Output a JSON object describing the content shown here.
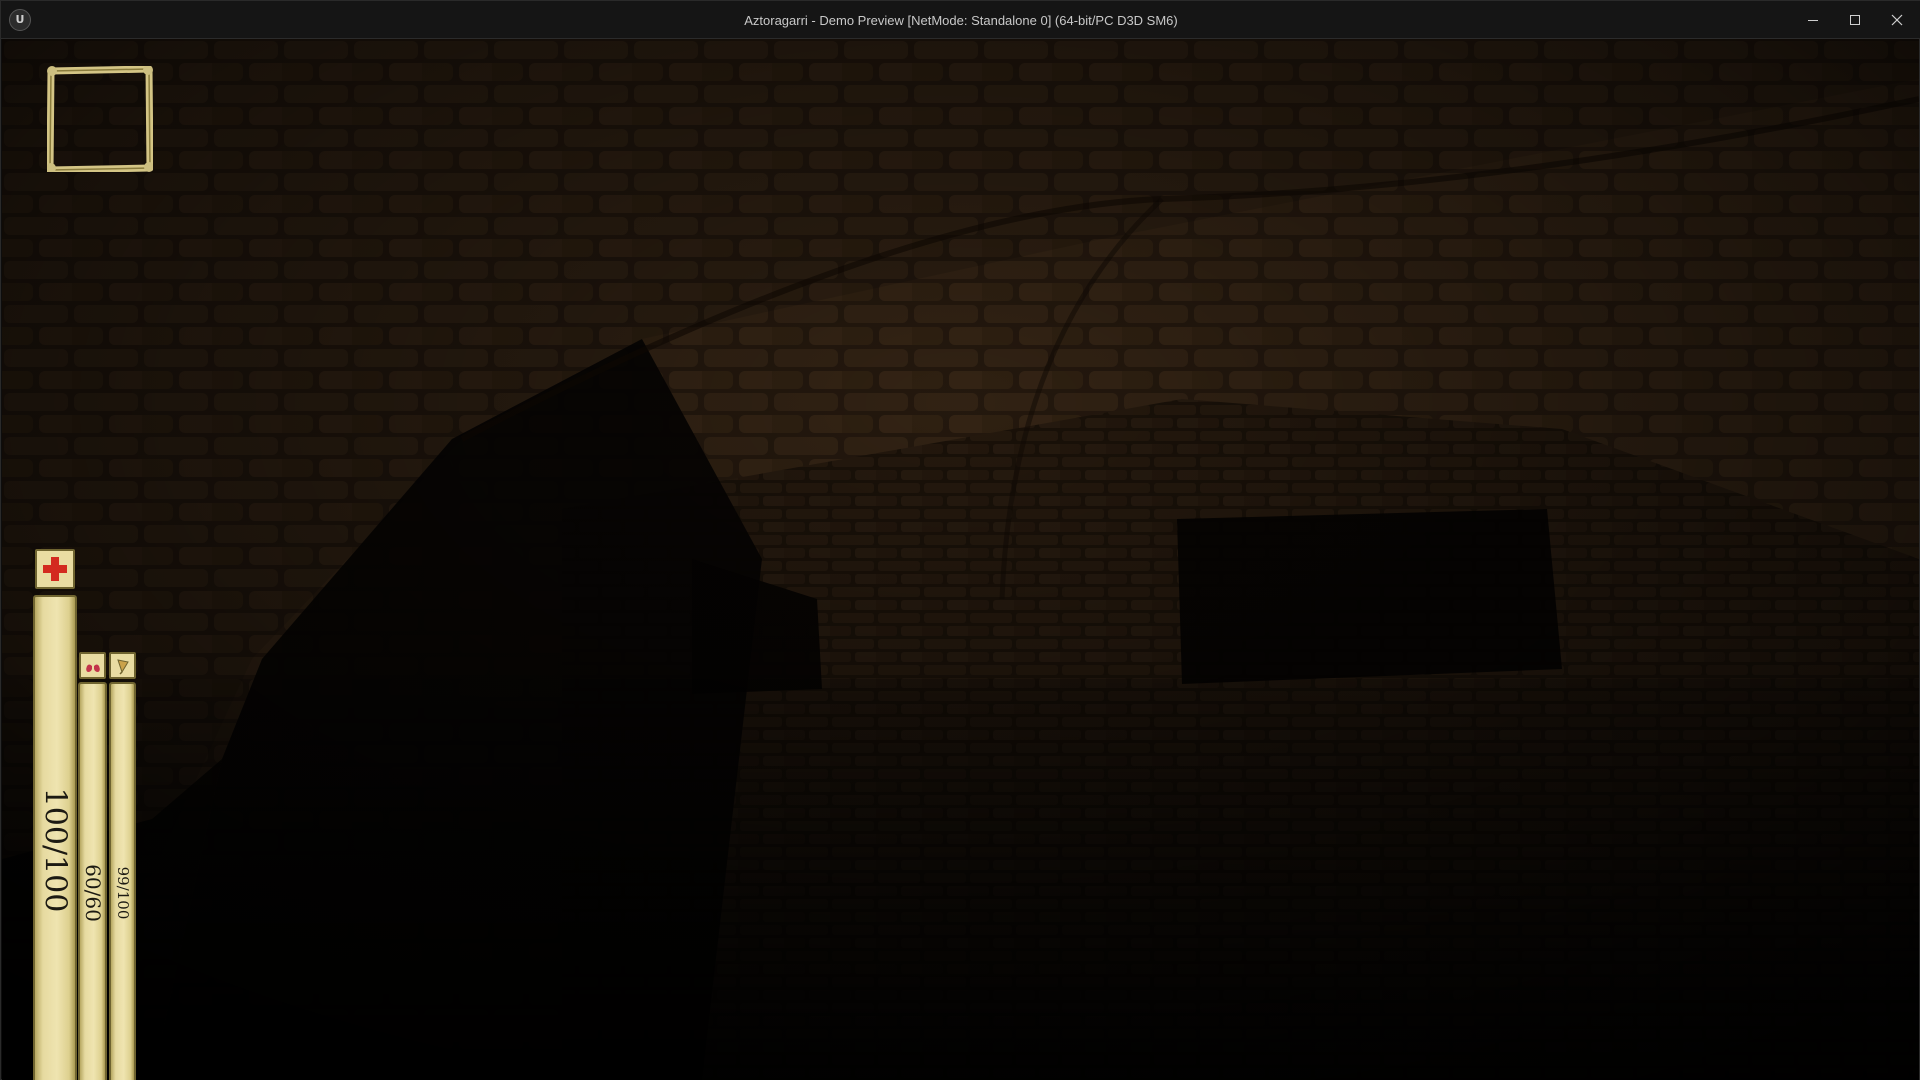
{
  "window": {
    "title": "Aztoragarri - Demo Preview [NetMode: Standalone 0]  (64-bit/PC D3D SM6)",
    "logo_text": "U"
  },
  "hud": {
    "health": {
      "current": 100,
      "max": 100,
      "label": "100/100",
      "fill": 1.0,
      "icon": "red-cross-icon",
      "icon_color": "#d32a1f"
    },
    "stamina": {
      "current": 60,
      "max": 60,
      "label": "60/60",
      "fill": 1.0,
      "icon": "lungs-icon",
      "icon_color": "#c2344a"
    },
    "hunger": {
      "current": 99,
      "max": 100,
      "label": "99/100",
      "fill": 0.99,
      "icon": "drumstick-icon",
      "icon_color": "#caa24a"
    }
  },
  "colors": {
    "parchment": "#e6daa0",
    "parchment_border": "#6f6430",
    "stone": "#3a2817",
    "mortar": "#140c06"
  }
}
